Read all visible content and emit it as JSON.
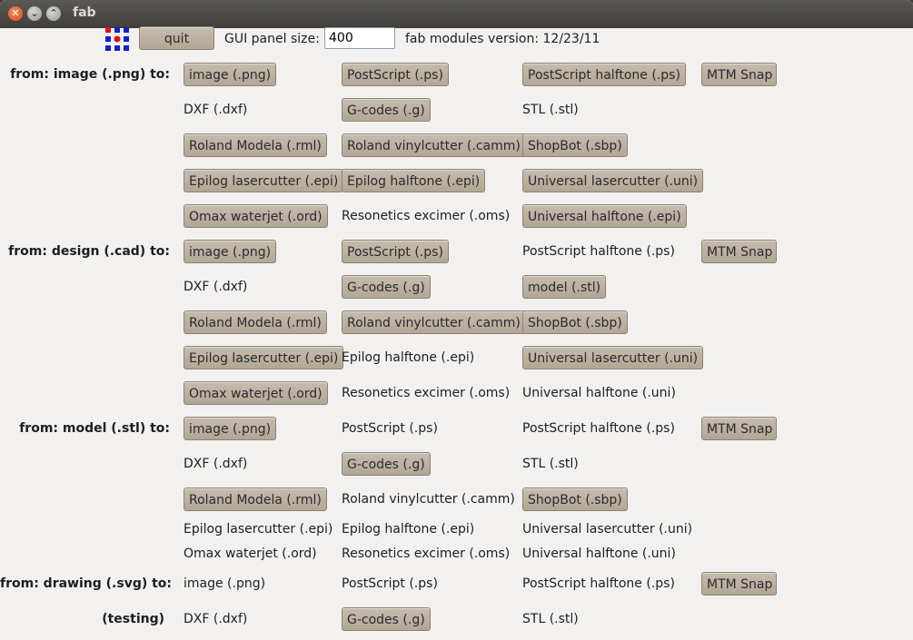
{
  "window": {
    "title": "fab"
  },
  "toolbar": {
    "quit_label": "quit",
    "panel_size_label": "GUI panel size:",
    "panel_size_value": "400",
    "version_text": "fab modules version: 12/23/11"
  },
  "rows": {
    "image": {
      "label": "from: image (.png)  to:",
      "items": [
        "image (.png)",
        "PostScript (.ps)",
        "PostScript halftone (.ps)",
        "MTM Snap",
        "DXF (.dxf)",
        "G-codes (.g)",
        "STL (.stl)",
        "Roland Modela (.rml)",
        "Roland vinylcutter (.camm)",
        "ShopBot (.sbp)",
        "Epilog lasercutter (.epi)",
        "Epilog halftone (.epi)",
        "Universal lasercutter (.uni)",
        "Omax waterjet (.ord)",
        "Resonetics excimer (.oms)",
        "Universal halftone (.epi)"
      ]
    },
    "design": {
      "label": "from: design (.cad)  to:",
      "items": [
        "image (.png)",
        "PostScript (.ps)",
        "PostScript halftone (.ps)",
        "MTM Snap",
        "DXF (.dxf)",
        "G-codes (.g)",
        "model (.stl)",
        "Roland Modela (.rml)",
        "Roland vinylcutter (.camm)",
        "ShopBot (.sbp)",
        "Epilog lasercutter (.epi)",
        "Epilog halftone (.epi)",
        "Universal lasercutter (.uni)",
        "Omax waterjet (.ord)",
        "Resonetics excimer (.oms)",
        "Universal halftone (.uni)"
      ]
    },
    "model": {
      "label": "from: model (.stl)  to:",
      "items": [
        "image (.png)",
        "PostScript (.ps)",
        "PostScript halftone (.ps)",
        "MTM Snap",
        "DXF (.dxf)",
        "G-codes (.g)",
        "STL (.stl)",
        "Roland Modela (.rml)",
        "Roland vinylcutter (.camm)",
        "ShopBot (.sbp)",
        "Epilog lasercutter (.epi)",
        "Epilog halftone (.epi)",
        "Universal lasercutter (.uni)",
        "Omax waterjet (.ord)",
        "Resonetics excimer (.oms)",
        "Universal halftone (.uni)"
      ]
    },
    "drawing": {
      "label": "from: drawing (.svg)  to:",
      "testing_label": "(testing)",
      "items": [
        "image (.png)",
        "PostScript (.ps)",
        "PostScript halftone (.ps)",
        "MTM Snap",
        "DXF (.dxf)",
        "G-codes (.g)",
        "STL (.stl)"
      ]
    }
  },
  "colors": {
    "button_bg": "#bdb3a5",
    "window_bg": "#f2f1f0",
    "titlebar": "#45443f",
    "close_button": "#e3541e"
  }
}
